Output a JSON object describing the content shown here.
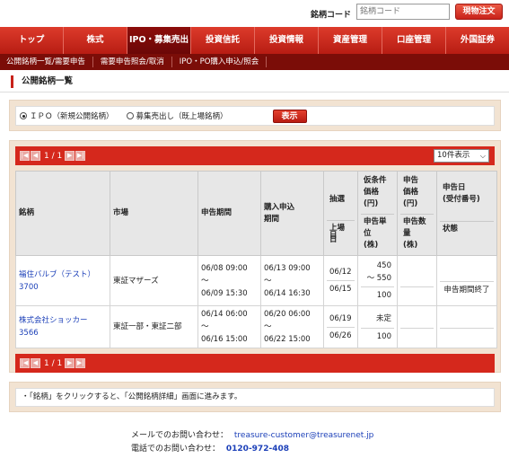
{
  "topbar": {
    "label": "銘柄コード",
    "placeholder": "銘柄コード",
    "button": "現物注文"
  },
  "mainnav": [
    "トップ",
    "株式",
    "IPO・募集売出",
    "投資信託",
    "投資情報",
    "資産管理",
    "口座管理",
    "外国証券"
  ],
  "subnav": [
    "公開銘柄一覧/需要申告",
    "需要申告照会/取消",
    "IPO・PO購入申込/照会"
  ],
  "heading": "公開銘柄一覧",
  "filter": {
    "option1": "ＩＰＯ（新規公開銘柄）",
    "option2": "募集売出し（既上場銘柄）",
    "show_button": "表示"
  },
  "pager": {
    "text": "1 / 1",
    "per_page": "10件表示"
  },
  "table": {
    "headers": {
      "name": "銘柄",
      "market": "市場",
      "period": "申告期間",
      "purchase": "購入申込\n期間",
      "lottery": "抽選日",
      "listing": "上場日",
      "price": "仮条件\n価格\n(円)",
      "unit": "申告単位\n(株)",
      "dec_price": "申告\n価格\n(円)",
      "dec_qty": "申告数量\n(株)",
      "dec_date": "申告日\n(受付番号)",
      "status": "状態"
    },
    "rows": [
      {
        "name": "福住バルブ（テスト）",
        "code": "3700",
        "market": "東証マザーズ",
        "period_from": "06/08 09:00",
        "period_to": "06/09 15:30",
        "purchase_from": "06/13 09:00",
        "purchase_to": "06/14 16:30",
        "lottery": "06/12",
        "listing": "06/15",
        "price_low": "450",
        "price_high": "～ 550",
        "unit": "100",
        "status": "申告期間終了"
      },
      {
        "name": "株式会社ショッカー",
        "code": "3566",
        "market": "東証一部・東証二部",
        "period_from": "06/14 06:00",
        "period_to": "06/16 15:00",
        "purchase_from": "06/20 06:00",
        "purchase_to": "06/22 15:00",
        "lottery": "06/19",
        "listing": "06/26",
        "price_low": "未定",
        "price_high": "",
        "unit": "100",
        "status": ""
      }
    ],
    "tilde": "～"
  },
  "note": "・「銘柄」をクリックすると、「公開銘柄詳細」画面に進みます。",
  "footer": {
    "mail_label": "メールでのお問い合わせ：",
    "mail_value": "treasure-customer@treasurenet.jp",
    "tel_label": "電話でのお問い合わせ：",
    "tel_value": "0120-972-408"
  }
}
